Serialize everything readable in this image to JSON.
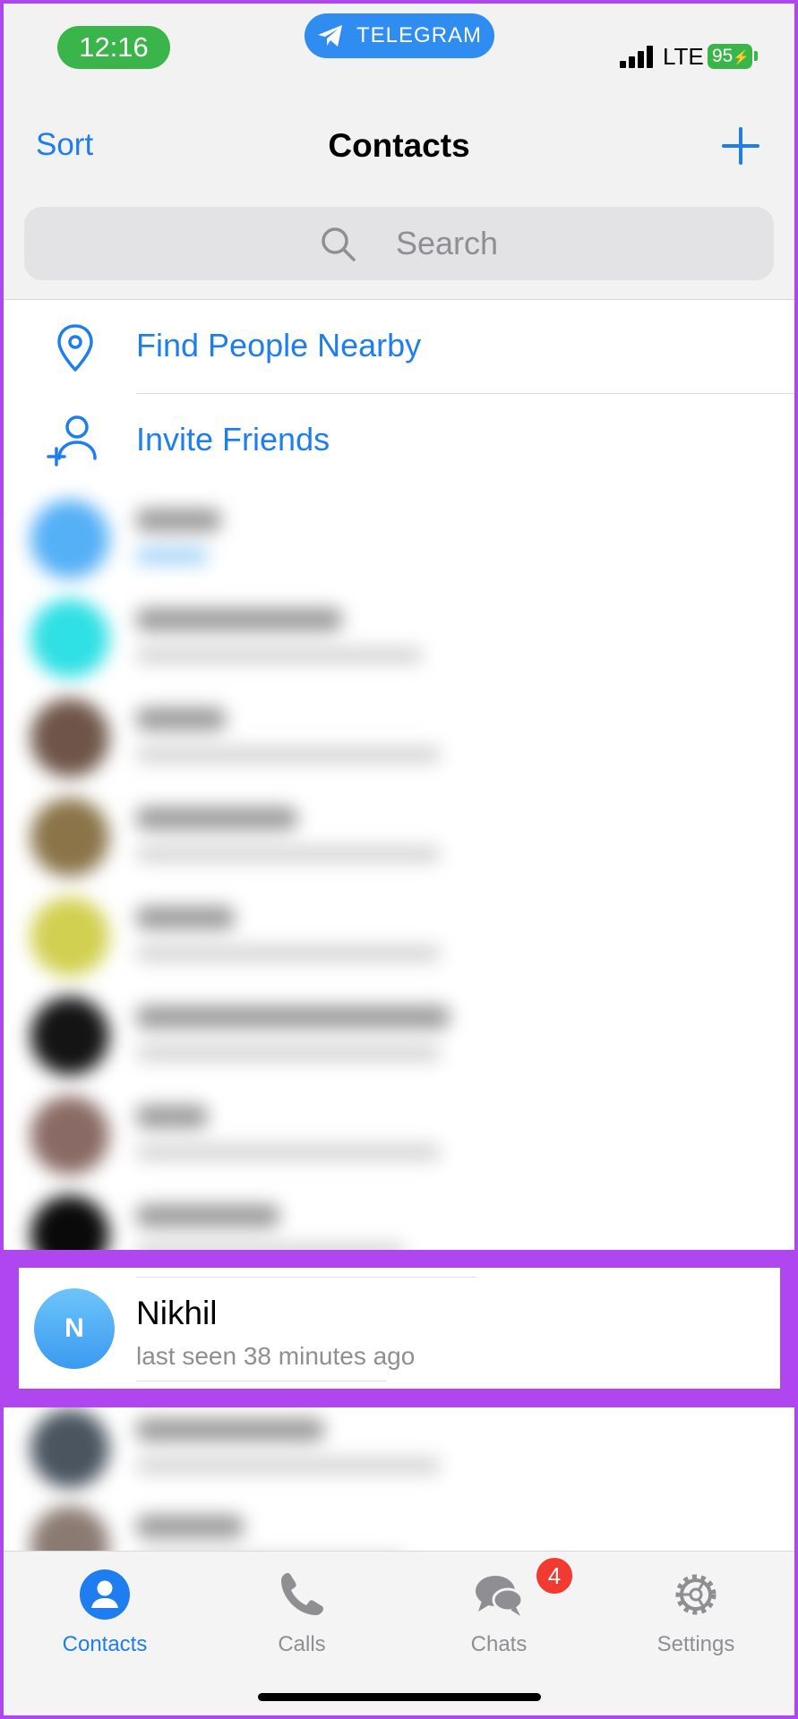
{
  "status_bar": {
    "time": "12:16",
    "app_pill": "TELEGRAM",
    "network": "LTE",
    "battery": "95"
  },
  "nav": {
    "sort_label": "Sort",
    "title": "Contacts"
  },
  "search": {
    "placeholder": "Search"
  },
  "actions": [
    {
      "label": "Find People Nearby",
      "icon": "location-pin-icon"
    },
    {
      "label": "Invite Friends",
      "icon": "add-person-icon"
    }
  ],
  "highlighted_contact": {
    "initial": "N",
    "name": "Nikhil",
    "status": "last seen 38 minutes ago"
  },
  "tabs": [
    {
      "label": "Contacts",
      "icon": "person-circle-icon",
      "active": true
    },
    {
      "label": "Calls",
      "icon": "phone-icon"
    },
    {
      "label": "Chats",
      "icon": "chat-bubbles-icon",
      "badge": "4"
    },
    {
      "label": "Settings",
      "icon": "gear-icon"
    }
  ],
  "colors": {
    "accent": "#1e7ef0",
    "highlight_frame": "#b046f0",
    "badge": "#f33a30"
  }
}
